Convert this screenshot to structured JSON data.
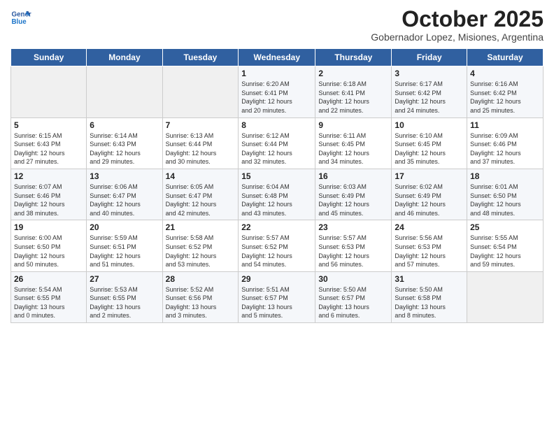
{
  "header": {
    "logo_line1": "General",
    "logo_line2": "Blue",
    "month": "October 2025",
    "location": "Gobernador Lopez, Misiones, Argentina"
  },
  "days_of_week": [
    "Sunday",
    "Monday",
    "Tuesday",
    "Wednesday",
    "Thursday",
    "Friday",
    "Saturday"
  ],
  "weeks": [
    [
      {
        "day": "",
        "info": ""
      },
      {
        "day": "",
        "info": ""
      },
      {
        "day": "",
        "info": ""
      },
      {
        "day": "1",
        "info": "Sunrise: 6:20 AM\nSunset: 6:41 PM\nDaylight: 12 hours\nand 20 minutes."
      },
      {
        "day": "2",
        "info": "Sunrise: 6:18 AM\nSunset: 6:41 PM\nDaylight: 12 hours\nand 22 minutes."
      },
      {
        "day": "3",
        "info": "Sunrise: 6:17 AM\nSunset: 6:42 PM\nDaylight: 12 hours\nand 24 minutes."
      },
      {
        "day": "4",
        "info": "Sunrise: 6:16 AM\nSunset: 6:42 PM\nDaylight: 12 hours\nand 25 minutes."
      }
    ],
    [
      {
        "day": "5",
        "info": "Sunrise: 6:15 AM\nSunset: 6:43 PM\nDaylight: 12 hours\nand 27 minutes."
      },
      {
        "day": "6",
        "info": "Sunrise: 6:14 AM\nSunset: 6:43 PM\nDaylight: 12 hours\nand 29 minutes."
      },
      {
        "day": "7",
        "info": "Sunrise: 6:13 AM\nSunset: 6:44 PM\nDaylight: 12 hours\nand 30 minutes."
      },
      {
        "day": "8",
        "info": "Sunrise: 6:12 AM\nSunset: 6:44 PM\nDaylight: 12 hours\nand 32 minutes."
      },
      {
        "day": "9",
        "info": "Sunrise: 6:11 AM\nSunset: 6:45 PM\nDaylight: 12 hours\nand 34 minutes."
      },
      {
        "day": "10",
        "info": "Sunrise: 6:10 AM\nSunset: 6:45 PM\nDaylight: 12 hours\nand 35 minutes."
      },
      {
        "day": "11",
        "info": "Sunrise: 6:09 AM\nSunset: 6:46 PM\nDaylight: 12 hours\nand 37 minutes."
      }
    ],
    [
      {
        "day": "12",
        "info": "Sunrise: 6:07 AM\nSunset: 6:46 PM\nDaylight: 12 hours\nand 38 minutes."
      },
      {
        "day": "13",
        "info": "Sunrise: 6:06 AM\nSunset: 6:47 PM\nDaylight: 12 hours\nand 40 minutes."
      },
      {
        "day": "14",
        "info": "Sunrise: 6:05 AM\nSunset: 6:47 PM\nDaylight: 12 hours\nand 42 minutes."
      },
      {
        "day": "15",
        "info": "Sunrise: 6:04 AM\nSunset: 6:48 PM\nDaylight: 12 hours\nand 43 minutes."
      },
      {
        "day": "16",
        "info": "Sunrise: 6:03 AM\nSunset: 6:49 PM\nDaylight: 12 hours\nand 45 minutes."
      },
      {
        "day": "17",
        "info": "Sunrise: 6:02 AM\nSunset: 6:49 PM\nDaylight: 12 hours\nand 46 minutes."
      },
      {
        "day": "18",
        "info": "Sunrise: 6:01 AM\nSunset: 6:50 PM\nDaylight: 12 hours\nand 48 minutes."
      }
    ],
    [
      {
        "day": "19",
        "info": "Sunrise: 6:00 AM\nSunset: 6:50 PM\nDaylight: 12 hours\nand 50 minutes."
      },
      {
        "day": "20",
        "info": "Sunrise: 5:59 AM\nSunset: 6:51 PM\nDaylight: 12 hours\nand 51 minutes."
      },
      {
        "day": "21",
        "info": "Sunrise: 5:58 AM\nSunset: 6:52 PM\nDaylight: 12 hours\nand 53 minutes."
      },
      {
        "day": "22",
        "info": "Sunrise: 5:57 AM\nSunset: 6:52 PM\nDaylight: 12 hours\nand 54 minutes."
      },
      {
        "day": "23",
        "info": "Sunrise: 5:57 AM\nSunset: 6:53 PM\nDaylight: 12 hours\nand 56 minutes."
      },
      {
        "day": "24",
        "info": "Sunrise: 5:56 AM\nSunset: 6:53 PM\nDaylight: 12 hours\nand 57 minutes."
      },
      {
        "day": "25",
        "info": "Sunrise: 5:55 AM\nSunset: 6:54 PM\nDaylight: 12 hours\nand 59 minutes."
      }
    ],
    [
      {
        "day": "26",
        "info": "Sunrise: 5:54 AM\nSunset: 6:55 PM\nDaylight: 13 hours\nand 0 minutes."
      },
      {
        "day": "27",
        "info": "Sunrise: 5:53 AM\nSunset: 6:55 PM\nDaylight: 13 hours\nand 2 minutes."
      },
      {
        "day": "28",
        "info": "Sunrise: 5:52 AM\nSunset: 6:56 PM\nDaylight: 13 hours\nand 3 minutes."
      },
      {
        "day": "29",
        "info": "Sunrise: 5:51 AM\nSunset: 6:57 PM\nDaylight: 13 hours\nand 5 minutes."
      },
      {
        "day": "30",
        "info": "Sunrise: 5:50 AM\nSunset: 6:57 PM\nDaylight: 13 hours\nand 6 minutes."
      },
      {
        "day": "31",
        "info": "Sunrise: 5:50 AM\nSunset: 6:58 PM\nDaylight: 13 hours\nand 8 minutes."
      },
      {
        "day": "",
        "info": ""
      }
    ]
  ]
}
